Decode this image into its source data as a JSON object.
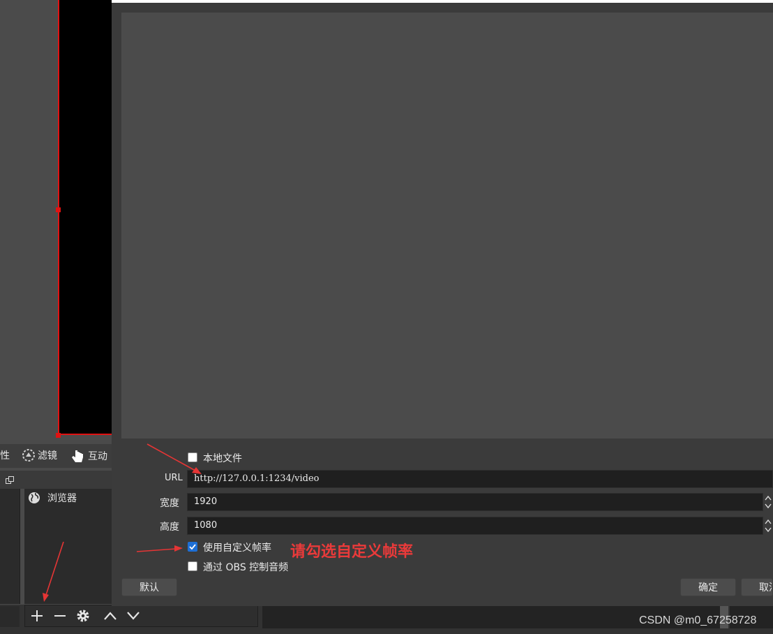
{
  "main_toolbar": {
    "properties_label": "性",
    "filters_label": "滤镜",
    "interact_label": "互动"
  },
  "sources": {
    "items": [
      {
        "label": "浏览器"
      }
    ]
  },
  "dialog": {
    "local_file_label": "本地文件",
    "local_file_checked": false,
    "url_label": "URL",
    "url_value": "http://127.0.0.1:1234/video",
    "width_label": "宽度",
    "width_value": "1920",
    "height_label": "高度",
    "height_value": "1080",
    "custom_fps_label": "使用自定义帧率",
    "custom_fps_checked": true,
    "obs_audio_label": "通过 OBS 控制音频",
    "obs_audio_checked": false,
    "defaults_button": "默认",
    "ok_button": "确定",
    "cancel_button": "取消"
  },
  "annotation": {
    "text": "请勾选自定义帧率",
    "color": "#ea3a3a"
  },
  "watermark": "CSDN @m0_67258728"
}
